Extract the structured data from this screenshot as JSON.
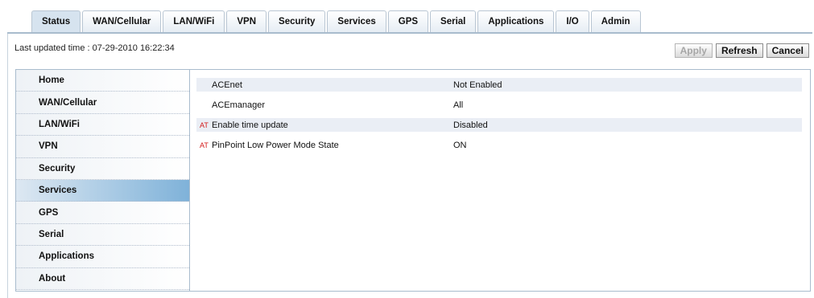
{
  "tabs": [
    {
      "label": "Status",
      "active": true
    },
    {
      "label": "WAN/Cellular",
      "active": false
    },
    {
      "label": "LAN/WiFi",
      "active": false
    },
    {
      "label": "VPN",
      "active": false
    },
    {
      "label": "Security",
      "active": false
    },
    {
      "label": "Services",
      "active": false
    },
    {
      "label": "GPS",
      "active": false
    },
    {
      "label": "Serial",
      "active": false
    },
    {
      "label": "Applications",
      "active": false
    },
    {
      "label": "I/O",
      "active": false
    },
    {
      "label": "Admin",
      "active": false
    }
  ],
  "header": {
    "last_updated": "Last updated time : 07-29-2010 16:22:34",
    "apply_label": "Apply",
    "refresh_label": "Refresh",
    "cancel_label": "Cancel"
  },
  "sidebar": {
    "items": [
      {
        "label": "Home",
        "active": false
      },
      {
        "label": "WAN/Cellular",
        "active": false
      },
      {
        "label": "LAN/WiFi",
        "active": false
      },
      {
        "label": "VPN",
        "active": false
      },
      {
        "label": "Security",
        "active": false
      },
      {
        "label": "Services",
        "active": true
      },
      {
        "label": "GPS",
        "active": false
      },
      {
        "label": "Serial",
        "active": false
      },
      {
        "label": "Applications",
        "active": false
      },
      {
        "label": "About",
        "active": false
      }
    ]
  },
  "content": {
    "rows": [
      {
        "at": "",
        "label": "ACEnet",
        "value": "Not Enabled"
      },
      {
        "at": "",
        "label": "ACEmanager",
        "value": "All"
      },
      {
        "at": "AT",
        "label": "Enable time update",
        "value": "Disabled"
      },
      {
        "at": "AT",
        "label": "PinPoint Low Power Mode State",
        "value": "ON"
      }
    ]
  },
  "colors": {
    "active_sidebar": "#7fb2d9",
    "at_marker": "#d31b1b",
    "border": "#a9bccd"
  }
}
